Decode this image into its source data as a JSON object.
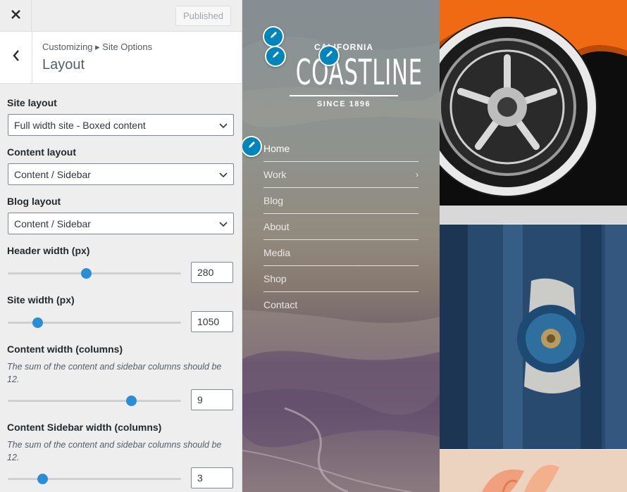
{
  "header": {
    "close_icon": "close-icon",
    "publish_label": "Published"
  },
  "section": {
    "back_icon": "chevron-left-icon",
    "breadcrumb": "Customizing ▸ Site Options",
    "title": "Layout"
  },
  "controls": {
    "site_layout": {
      "label": "Site layout",
      "value": "Full width site - Boxed content"
    },
    "content_layout": {
      "label": "Content layout",
      "value": "Content / Sidebar"
    },
    "blog_layout": {
      "label": "Blog layout",
      "value": "Content / Sidebar"
    },
    "header_width": {
      "label": "Header width (px)",
      "value": "280",
      "slider_fraction": 0.45
    },
    "site_width": {
      "label": "Site width (px)",
      "value": "1050",
      "slider_fraction": 0.17
    },
    "content_width": {
      "label": "Content width (columns)",
      "description": "The sum of the content and sidebar columns should be 12.",
      "value": "9",
      "slider_fraction": 0.71
    },
    "sidebar_width": {
      "label": "Content Sidebar width (columns)",
      "description": "The sum of the content and sidebar columns should be 12.",
      "value": "3",
      "slider_fraction": 0.2
    }
  },
  "preview": {
    "logo": {
      "top": "CALIFORNIA",
      "main": "COASTLINE",
      "bottom": "SINCE 1896"
    },
    "nav": [
      "Home",
      "Work",
      "Blog",
      "About",
      "Media",
      "Shop",
      "Contact"
    ],
    "nav_submenu_indicator": "›",
    "edit_icon": "pencil-icon"
  },
  "colors": {
    "accent": "#2a8ed4",
    "shortcut": "#0085ba"
  }
}
